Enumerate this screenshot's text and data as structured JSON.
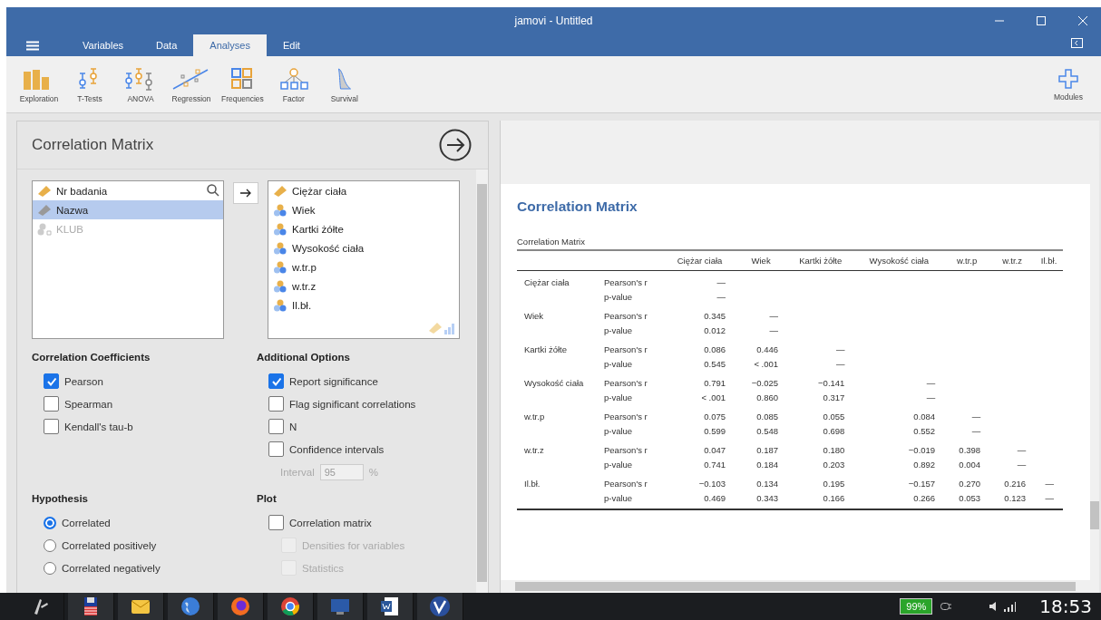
{
  "window": {
    "title": "jamovi - Untitled"
  },
  "tabs": [
    {
      "label": "Variables",
      "selected": false
    },
    {
      "label": "Data",
      "selected": false
    },
    {
      "label": "Analyses",
      "selected": true
    },
    {
      "label": "Edit",
      "selected": false
    }
  ],
  "ribbon": [
    {
      "label": "Exploration",
      "kind": "exploration"
    },
    {
      "label": "T-Tests",
      "kind": "ttests"
    },
    {
      "label": "ANOVA",
      "kind": "anova"
    },
    {
      "label": "Regression",
      "kind": "regression"
    },
    {
      "label": "Frequencies",
      "kind": "frequencies"
    },
    {
      "label": "Factor",
      "kind": "factor"
    },
    {
      "label": "Survival",
      "kind": "survival"
    }
  ],
  "modules": {
    "label": "Modules"
  },
  "analysis": {
    "title": "Correlation Matrix",
    "available": [
      {
        "name": "Nr badania",
        "kind": "continuous",
        "selected": false,
        "disabled": false
      },
      {
        "name": "Nazwa",
        "kind": "id",
        "selected": true,
        "disabled": false
      },
      {
        "name": "KLUB",
        "kind": "nominal-text",
        "selected": false,
        "disabled": true
      }
    ],
    "chosen": [
      {
        "name": "Ciężar ciała",
        "kind": "continuous"
      },
      {
        "name": "Wiek",
        "kind": "nominal"
      },
      {
        "name": "Kartki żółte",
        "kind": "nominal"
      },
      {
        "name": "Wysokość ciała",
        "kind": "nominal"
      },
      {
        "name": "w.tr.p",
        "kind": "nominal"
      },
      {
        "name": "w.tr.z",
        "kind": "nominal"
      },
      {
        "name": "Il.bł.",
        "kind": "nominal"
      }
    ],
    "coefficients": {
      "title": "Correlation Coefficients",
      "options": [
        {
          "label": "Pearson",
          "checked": true,
          "disabled": false
        },
        {
          "label": "Spearman",
          "checked": false,
          "disabled": false
        },
        {
          "label": "Kendall's tau-b",
          "checked": false,
          "disabled": false
        }
      ]
    },
    "additional": {
      "title": "Additional Options",
      "options": [
        {
          "label": "Report significance",
          "checked": true,
          "disabled": false
        },
        {
          "label": "Flag significant correlations",
          "checked": false,
          "disabled": false
        },
        {
          "label": "N",
          "checked": false,
          "disabled": false
        },
        {
          "label": "Confidence intervals",
          "checked": false,
          "disabled": false
        }
      ],
      "interval": {
        "label": "Interval",
        "value": "95",
        "unit": "%",
        "disabled": true
      }
    },
    "hypothesis": {
      "title": "Hypothesis",
      "options": [
        {
          "label": "Correlated",
          "selected": true
        },
        {
          "label": "Correlated positively",
          "selected": false
        },
        {
          "label": "Correlated negatively",
          "selected": false
        }
      ]
    },
    "plot": {
      "title": "Plot",
      "options": [
        {
          "label": "Correlation matrix",
          "checked": false,
          "disabled": false,
          "sub": false
        },
        {
          "label": "Densities for variables",
          "checked": false,
          "disabled": true,
          "sub": true
        },
        {
          "label": "Statistics",
          "checked": false,
          "disabled": true,
          "sub": true
        }
      ]
    }
  },
  "results": {
    "heading": "Correlation Matrix",
    "table": {
      "caption": "Correlation Matrix",
      "columns": [
        "Ciężar ciała",
        "Wiek",
        "Kartki żółte",
        "Wysokość ciała",
        "w.tr.p",
        "w.tr.z",
        "Il.bł."
      ],
      "rows": [
        {
          "name": "Ciężar ciała",
          "r_label": "Pearson's r",
          "r": [
            "—"
          ],
          "p_label": "p-value",
          "p": [
            "—"
          ]
        },
        {
          "name": "Wiek",
          "r_label": "Pearson's r",
          "r": [
            "0.345",
            "—"
          ],
          "p_label": "p-value",
          "p": [
            "0.012",
            "—"
          ]
        },
        {
          "name": "Kartki żółte",
          "r_label": "Pearson's r",
          "r": [
            "0.086",
            "0.446",
            "—"
          ],
          "p_label": "p-value",
          "p": [
            "0.545",
            "< .001",
            "—"
          ]
        },
        {
          "name": "Wysokość ciała",
          "r_label": "Pearson's r",
          "r": [
            "0.791",
            "−0.025",
            "−0.141",
            "—"
          ],
          "p_label": "p-value",
          "p": [
            "< .001",
            "0.860",
            "0.317",
            "—"
          ]
        },
        {
          "name": "w.tr.p",
          "r_label": "Pearson's r",
          "r": [
            "0.075",
            "0.085",
            "0.055",
            "0.084",
            "—"
          ],
          "p_label": "p-value",
          "p": [
            "0.599",
            "0.548",
            "0.698",
            "0.552",
            "—"
          ]
        },
        {
          "name": "w.tr.z",
          "r_label": "Pearson's r",
          "r": [
            "0.047",
            "0.187",
            "0.180",
            "−0.019",
            "0.398",
            "—"
          ],
          "p_label": "p-value",
          "p": [
            "0.741",
            "0.184",
            "0.203",
            "0.892",
            "0.004",
            "—"
          ]
        },
        {
          "name": "Il.bł.",
          "r_label": "Pearson's r",
          "r": [
            "−0.103",
            "0.134",
            "0.195",
            "−0.157",
            "0.270",
            "0.216",
            "—"
          ],
          "p_label": "p-value",
          "p": [
            "0.469",
            "0.343",
            "0.166",
            "0.266",
            "0.053",
            "0.123",
            "—"
          ]
        }
      ]
    }
  },
  "taskbar": {
    "apps": [
      {
        "kind": "start"
      },
      {
        "kind": "disk"
      },
      {
        "kind": "mail"
      },
      {
        "kind": "globe"
      },
      {
        "kind": "firefox"
      },
      {
        "kind": "chrome"
      },
      {
        "kind": "monitor"
      },
      {
        "kind": "document"
      },
      {
        "kind": "app"
      }
    ],
    "battery": "99%",
    "time": "18:53"
  }
}
